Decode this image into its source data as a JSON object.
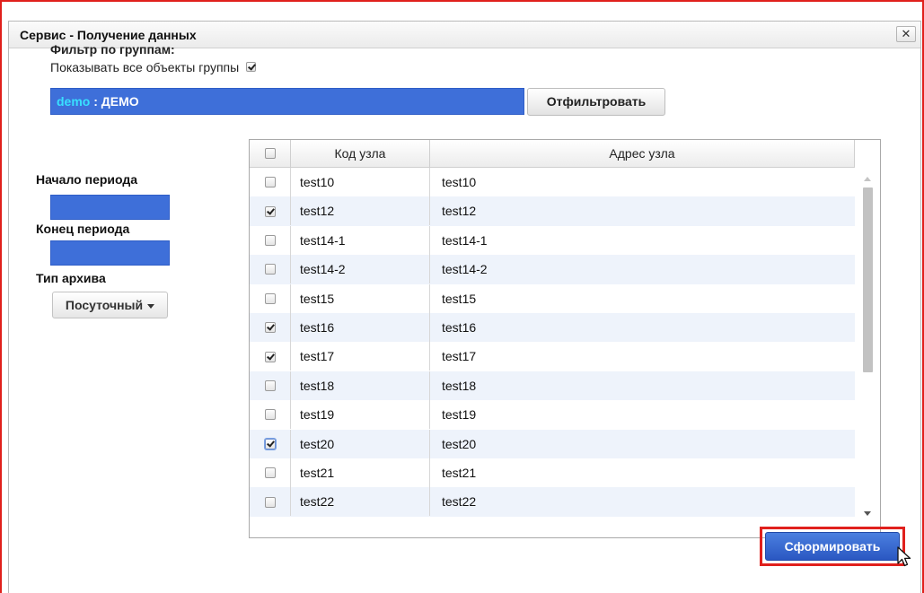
{
  "dialog": {
    "title": "Сервис - Получение данных",
    "close_label": "✕"
  },
  "filter": {
    "title": "Фильтр по группам:",
    "show_all_label": "Показывать все объекты группы",
    "show_all_checked": true,
    "group_code": "demo",
    "group_separator": " : ",
    "group_name": "ДЕМО",
    "filter_button": "Отфильтровать"
  },
  "period": {
    "start_label": "Начало периода",
    "start_value": "",
    "end_label": "Конец периода",
    "end_value": "",
    "archive_label": "Тип архива",
    "archive_value": "Посуточный"
  },
  "grid": {
    "columns": [
      "Код узла",
      "Адрес узла"
    ],
    "header_checked": false,
    "rows": [
      {
        "code": "test10",
        "address": "test10",
        "checked": false
      },
      {
        "code": "test12",
        "address": "test12",
        "checked": true
      },
      {
        "code": "test14-1",
        "address": "test14-1",
        "checked": false
      },
      {
        "code": "test14-2",
        "address": "test14-2",
        "checked": false
      },
      {
        "code": "test15",
        "address": "test15",
        "checked": false
      },
      {
        "code": "test16",
        "address": "test16",
        "checked": true
      },
      {
        "code": "test17",
        "address": "test17",
        "checked": true
      },
      {
        "code": "test18",
        "address": "test18",
        "checked": false
      },
      {
        "code": "test19",
        "address": "test19",
        "checked": false
      },
      {
        "code": "test20",
        "address": "test20",
        "checked": true
      },
      {
        "code": "test21",
        "address": "test21",
        "checked": false
      },
      {
        "code": "test22",
        "address": "test22",
        "checked": false
      }
    ]
  },
  "actions": {
    "submit_label": "Сформировать"
  },
  "colors": {
    "input_blue": "#3e6fd9",
    "group_code": "#38e0ff",
    "highlight_red": "#e0201c",
    "row_alt": "#eef3fb"
  }
}
